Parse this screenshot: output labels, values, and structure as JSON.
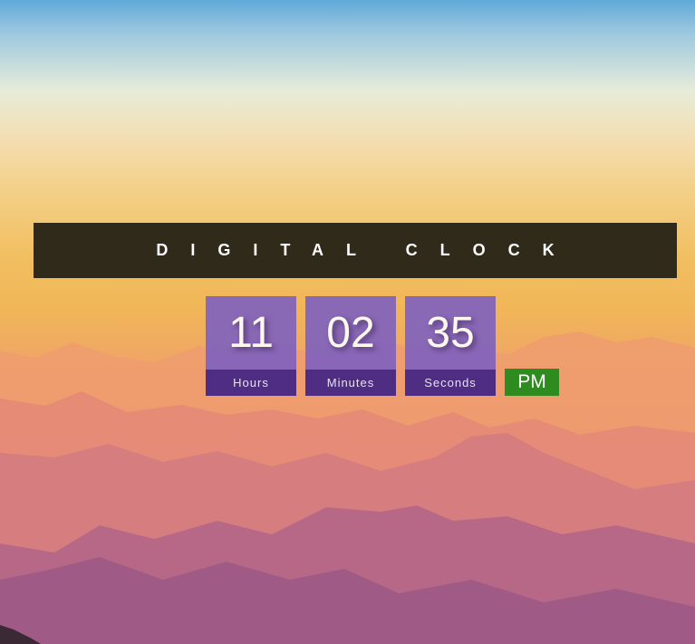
{
  "title": "DIGITAL CLOCK",
  "clock": {
    "hours": "11",
    "minutes": "02",
    "seconds": "35",
    "hours_label": "Hours",
    "minutes_label": "Minutes",
    "seconds_label": "Seconds",
    "period": "PM"
  },
  "colors": {
    "title_bar": "#2f2a1a",
    "digit_tile": "#8062be",
    "label_strip": "#4f2d82",
    "period_badge": "#2e8b1f"
  }
}
